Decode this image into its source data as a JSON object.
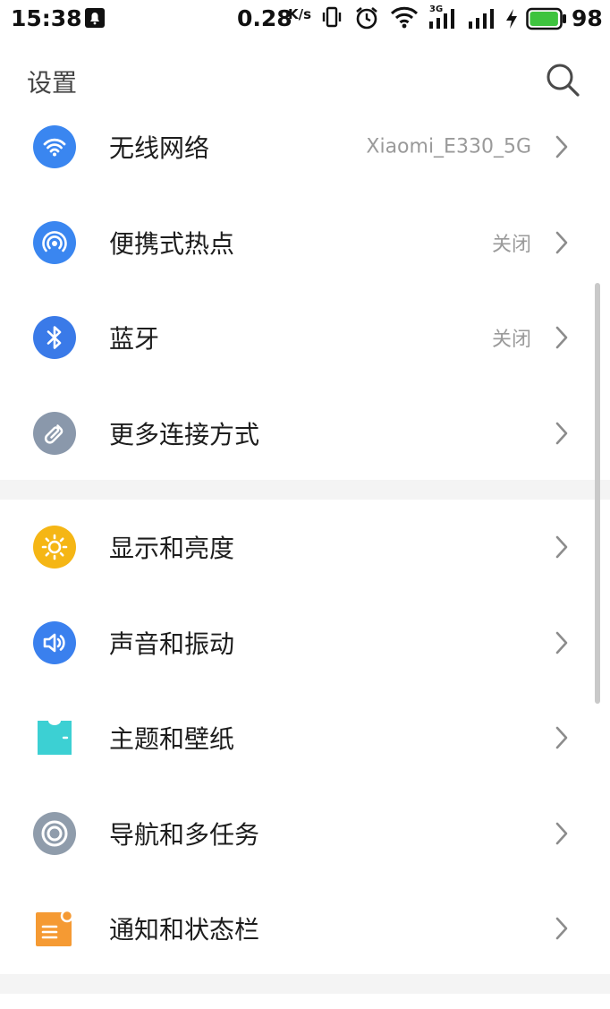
{
  "status_bar": {
    "time": "15:38",
    "speed": "0.28",
    "speed_unit": "K/s",
    "network_label": "3G",
    "battery_percent": "98",
    "battery_level": 0.98,
    "battery_color": "#3ec33e"
  },
  "header": {
    "title": "设置"
  },
  "sections": [
    {
      "items": [
        {
          "label": "无线网络",
          "value": "Xiaomi_E330_5G",
          "icon": "wifi-icon",
          "color": "#3a86f0"
        },
        {
          "label": "便携式热点",
          "value": "关闭",
          "icon": "hotspot-icon",
          "color": "#3a86f0"
        },
        {
          "label": "蓝牙",
          "value": "关闭",
          "icon": "bluetooth-icon",
          "color": "#3a7ae8"
        },
        {
          "label": "更多连接方式",
          "value": "",
          "icon": "link-icon",
          "color": "#8a98ab"
        }
      ]
    },
    {
      "items": [
        {
          "label": "显示和亮度",
          "value": "",
          "icon": "sun-icon",
          "color": "#f5b615"
        },
        {
          "label": "声音和振动",
          "value": "",
          "icon": "speaker-icon",
          "color": "#3a80ee"
        },
        {
          "label": "主题和壁纸",
          "value": "",
          "icon": "shirt-icon",
          "color": "#3cd0d3"
        },
        {
          "label": "导航和多任务",
          "value": "",
          "icon": "navigation-icon",
          "color": "#8f9cab"
        },
        {
          "label": "通知和状态栏",
          "value": "",
          "icon": "notification-icon",
          "color": "#f59a33"
        }
      ]
    }
  ]
}
